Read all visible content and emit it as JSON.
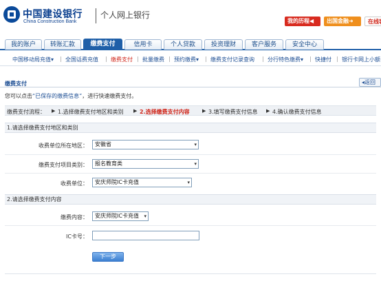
{
  "header": {
    "bank_name_cn": "中国建设银行",
    "bank_name_en": "China Construction Bank",
    "subtitle": "个人网上银行",
    "btn_history": "我的历程◀",
    "btn_abroad": "出国金融➜",
    "btn_online": "在线客"
  },
  "tabs": [
    {
      "label": "我的账户"
    },
    {
      "label": "转账汇款"
    },
    {
      "label": "缴费支付"
    },
    {
      "label": "信用卡"
    },
    {
      "label": "个人贷款"
    },
    {
      "label": "投资理财"
    },
    {
      "label": "客户服务"
    },
    {
      "label": "安全中心"
    }
  ],
  "subnav": [
    {
      "label": "中国移动局充值▾"
    },
    {
      "label": "全国话费充值"
    },
    {
      "label": "缴费支付"
    },
    {
      "label": "批量缴费"
    },
    {
      "label": "预约缴费▾"
    },
    {
      "label": "缴费支付记录查询"
    },
    {
      "label": "分行特色缴费▾"
    },
    {
      "label": "快捷付"
    },
    {
      "label": "银行卡网上小额"
    }
  ],
  "section": {
    "title": "缴费支付",
    "back": "◂返回"
  },
  "hint": {
    "prefix": "您可以点击",
    "link": "“已保存的缴费信息”",
    "suffix": "，进行快速缴费支付。"
  },
  "steps": {
    "label": "缴费支付流程：",
    "items": [
      {
        "label": "1.选择缴费支付地区和类别"
      },
      {
        "label": "2.选择缴费支付内容"
      },
      {
        "label": "3.填写缴费支付信息"
      },
      {
        "label": "4.确认缴费支付信息"
      }
    ]
  },
  "group1": {
    "title": "1.请选择缴费支付地区和类别",
    "region_label": "收费单位所在地区：",
    "region_value": "安徽省",
    "category_label": "缴费支付项目类别：",
    "category_value": "报名教育类",
    "unit_label": "收费单位：",
    "unit_value": "安庆师院IC卡充值"
  },
  "group2": {
    "title": "2.请选择缴费支付内容",
    "content_label": "缴费内容：",
    "content_value": "安庆师院IC卡充值",
    "card_label": "IC卡号：",
    "card_value": ""
  },
  "submit_label": "下一步"
}
